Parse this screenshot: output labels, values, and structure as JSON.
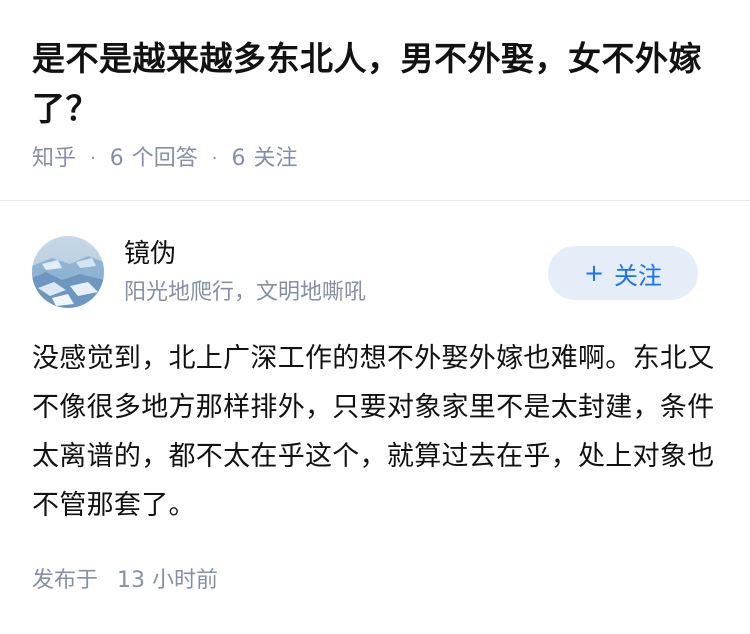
{
  "question": {
    "title": "是不是越来越多东北人，男不外娶，女不外嫁了？",
    "source": "知乎",
    "answers_count": "6",
    "answers_label": "个回答",
    "followers_count": "6",
    "followers_label": "关注"
  },
  "author": {
    "name": "镜伪",
    "bio": "阳光地爬行，文明地嘶吼",
    "follow_label": "关注",
    "follow_icon": "plus-icon"
  },
  "answer": {
    "content": "没感觉到，北上广深工作的想不外娶外嫁也难啊。东北又不像很多地方那样排外，只要对象家里不是太封建，条件太离谱的，都不太在乎这个，就算过去在乎，处上对象也不管那套了。",
    "published_label": "发布于",
    "published_time": "13 小时前"
  },
  "colors": {
    "accent": "#1772f6",
    "accent_bg": "#e5eef8",
    "meta_text": "#8590a6",
    "primary_text": "#121212"
  }
}
